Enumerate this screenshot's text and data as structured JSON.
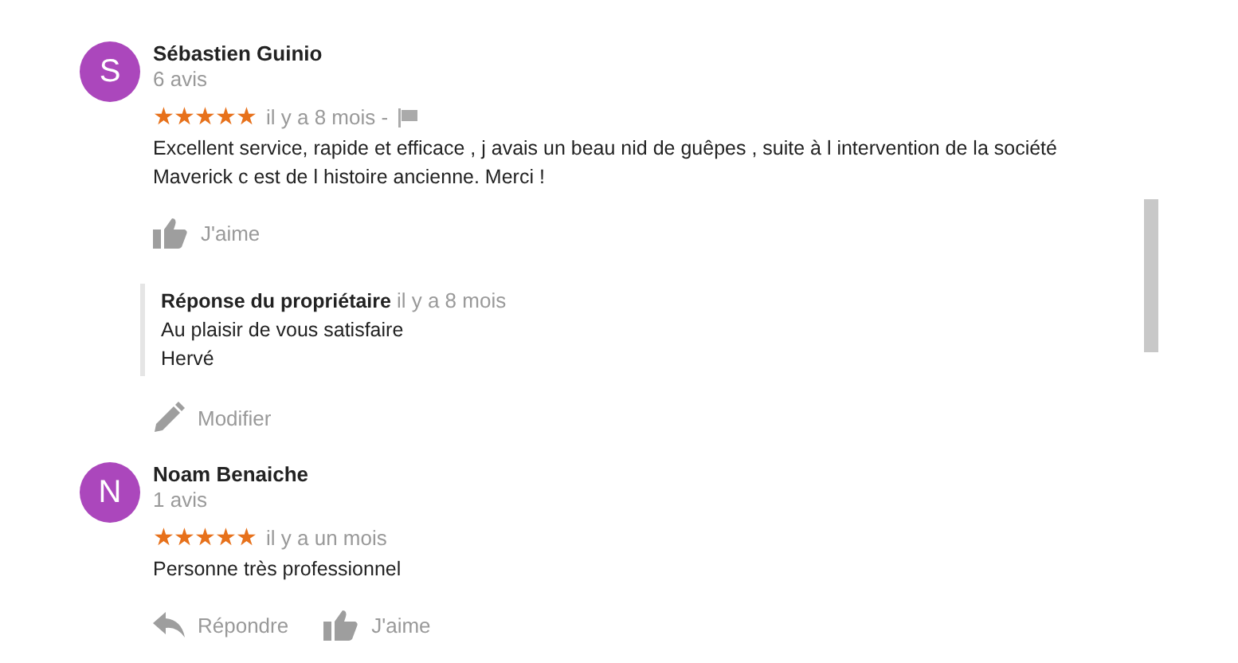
{
  "reviews": [
    {
      "initial": "S",
      "color": "#ab47bc",
      "name": "Sébastien Guinio",
      "count": "6 avis",
      "stars": 5,
      "date": "il y a 8 mois -",
      "report_flag": true,
      "text": "Excellent service, rapide et efficace , j avais un beau nid de guêpes  , suite à l intervention de la société Maverick c est de l histoire ancienne. Merci !",
      "actions": [
        {
          "kind": "like",
          "label": "J'aime"
        }
      ],
      "owner_reply": {
        "title": "Réponse du propriétaire",
        "date": "il y a 8 mois",
        "lines": [
          "Au plaisir de vous satisfaire",
          "Hervé"
        ],
        "actions": [
          {
            "kind": "edit",
            "label": "Modifier"
          }
        ]
      }
    },
    {
      "initial": "N",
      "color": "#ab47bc",
      "name": "Noam Benaiche",
      "count": "1 avis",
      "stars": 5,
      "date": "il y a un mois",
      "report_flag": false,
      "text": "Personne très professionnel",
      "actions": [
        {
          "kind": "reply",
          "label": "Répondre"
        },
        {
          "kind": "like",
          "label": "J'aime"
        }
      ]
    }
  ]
}
